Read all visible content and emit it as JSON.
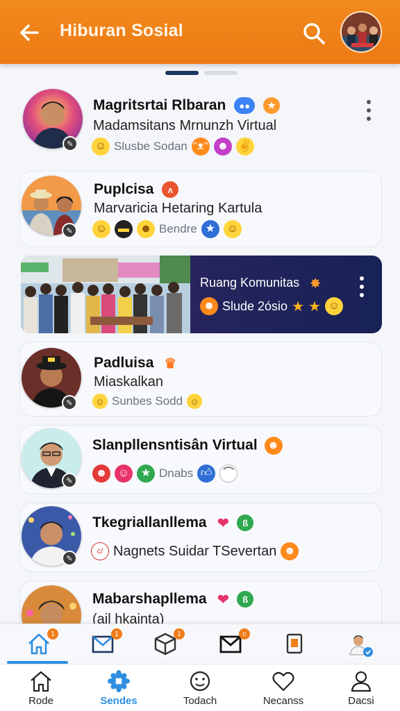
{
  "header": {
    "title": "Hiburan Sosial",
    "back_icon": "arrow-left-icon",
    "search_icon": "search-icon",
    "accent": "#ec7a12"
  },
  "pager": {
    "pages": 2,
    "active": 1
  },
  "feed": [
    {
      "name": "Magritsrtai Rlbaran",
      "subtitle": "Madamsitans Mrnunzh Virtual",
      "reaction_text": "Slusbe Sodan",
      "badge_icons": [
        "chat-bubble-icon",
        "star-burst-icon"
      ],
      "has_menu": true
    },
    {
      "name": "Puplcisa",
      "subtitle": "Marvaricia Hetaring Kartula",
      "reaction_text": "Bendre",
      "badge_icons": [
        "share-icon"
      ]
    },
    {
      "name": "Padluisa",
      "subtitle": "Miaskalkan",
      "reaction_text": "Sunbes Sodd",
      "badge_icons": [
        "crown-icon"
      ]
    },
    {
      "name": "Slanpllensntisân Virtual",
      "subtitle": "",
      "reaction_text": "Dnabs",
      "badge_icons": [
        "smile-icon"
      ]
    },
    {
      "name": "Tkegriallanllema",
      "subtitle": "Nagnets Suidar TSevertan",
      "reaction_text": "",
      "badge_icons": [
        "location-pin-icon",
        "green-badge-icon"
      ]
    },
    {
      "name": "Mabarshapllema",
      "subtitle": "(ail hkainta)",
      "reaction_text": "",
      "badge_icons": [
        "location-pin-icon",
        "green-badge-icon"
      ]
    }
  ],
  "community_banner": {
    "title": "Ruang Komunitas",
    "subtitle": "Slude 2ósio"
  },
  "tabbar": [
    {
      "icon": "home-icon",
      "count": "1",
      "active": true
    },
    {
      "icon": "mail-icon",
      "count": "1"
    },
    {
      "icon": "box-icon",
      "count": "1"
    },
    {
      "icon": "envelope-icon",
      "count": "c"
    },
    {
      "icon": "tablet-icon",
      "count": ""
    },
    {
      "icon": "profile-bubble-icon",
      "count": ""
    }
  ],
  "bottom_nav": [
    {
      "label": "Rode",
      "icon": "home-outline-icon"
    },
    {
      "label": "Sendes",
      "icon": "flower-icon",
      "active": true
    },
    {
      "label": "Todach",
      "icon": "smile-circle-icon"
    },
    {
      "label": "Necanss",
      "icon": "heart-icon"
    },
    {
      "label": "Dacsi",
      "icon": "person-icon"
    }
  ]
}
